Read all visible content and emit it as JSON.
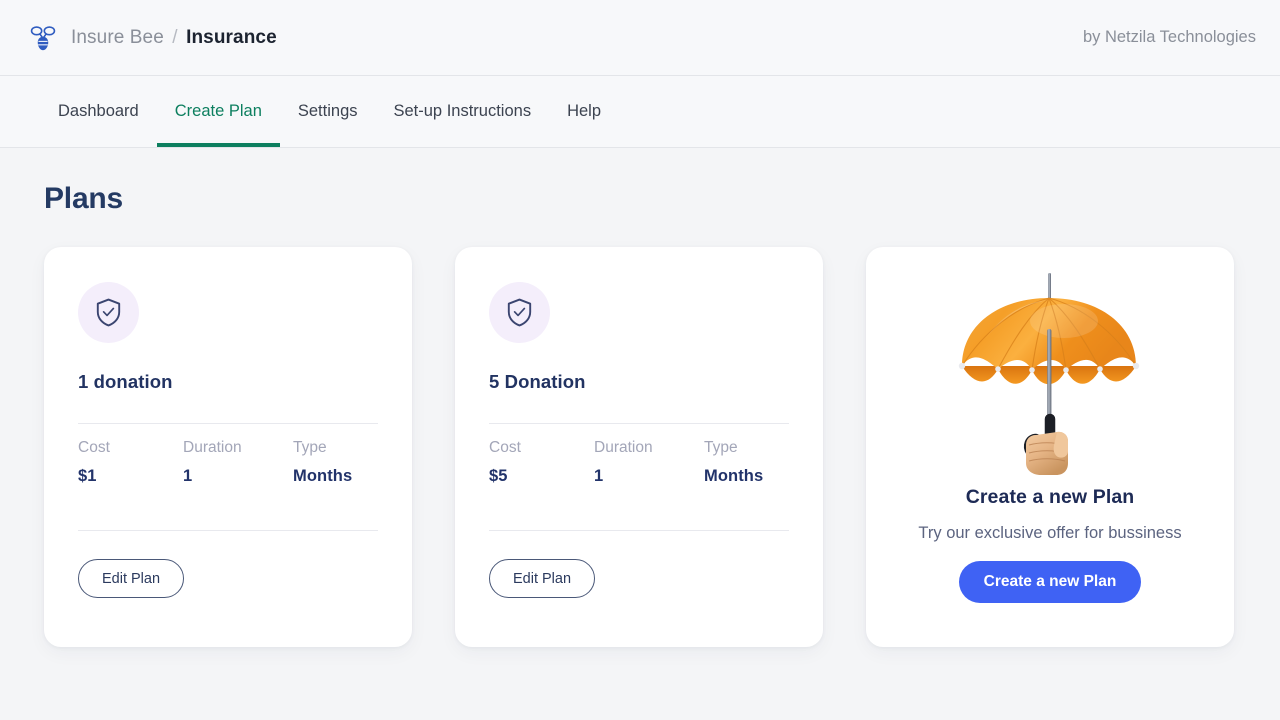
{
  "header": {
    "logo_icon": "bee-icon",
    "breadcrumb": {
      "first": "Insure Bee",
      "separator": "/",
      "last": "Insurance"
    },
    "byline": "by Netzila Technologies"
  },
  "nav": {
    "items": [
      {
        "label": "Dashboard",
        "active": false
      },
      {
        "label": "Create Plan",
        "active": true
      },
      {
        "label": "Settings",
        "active": false
      },
      {
        "label": "Set-up Instructions",
        "active": false
      },
      {
        "label": "Help",
        "active": false
      }
    ],
    "active_color": "#0d7f5f"
  },
  "main": {
    "page_title": "Plans",
    "spec_headers": {
      "cost": "Cost",
      "duration": "Duration",
      "type": "Type"
    },
    "plans": [
      {
        "icon": "shield-check-icon",
        "name": "1 donation",
        "cost": "$1",
        "duration": "1",
        "type": "Months",
        "edit_label": "Edit Plan"
      },
      {
        "icon": "shield-check-icon",
        "name": "5 Donation",
        "cost": "$5",
        "duration": "1",
        "type": "Months",
        "edit_label": "Edit Plan"
      }
    ],
    "promo": {
      "illustration": "orange-umbrella-in-hand-image",
      "title": "Create a new Plan",
      "subtitle": "Try our exclusive offer for bussiness",
      "button_label": "Create a new Plan",
      "button_color": "#3f62f4"
    }
  },
  "theme": {
    "page_background": "#f4f5f7",
    "card_background": "#ffffff",
    "title_navy": "#243a63",
    "muted_label": "#a3a6b8",
    "icon_circle_background": "#f4eefb",
    "umbrella_orange": "#f0952a"
  }
}
